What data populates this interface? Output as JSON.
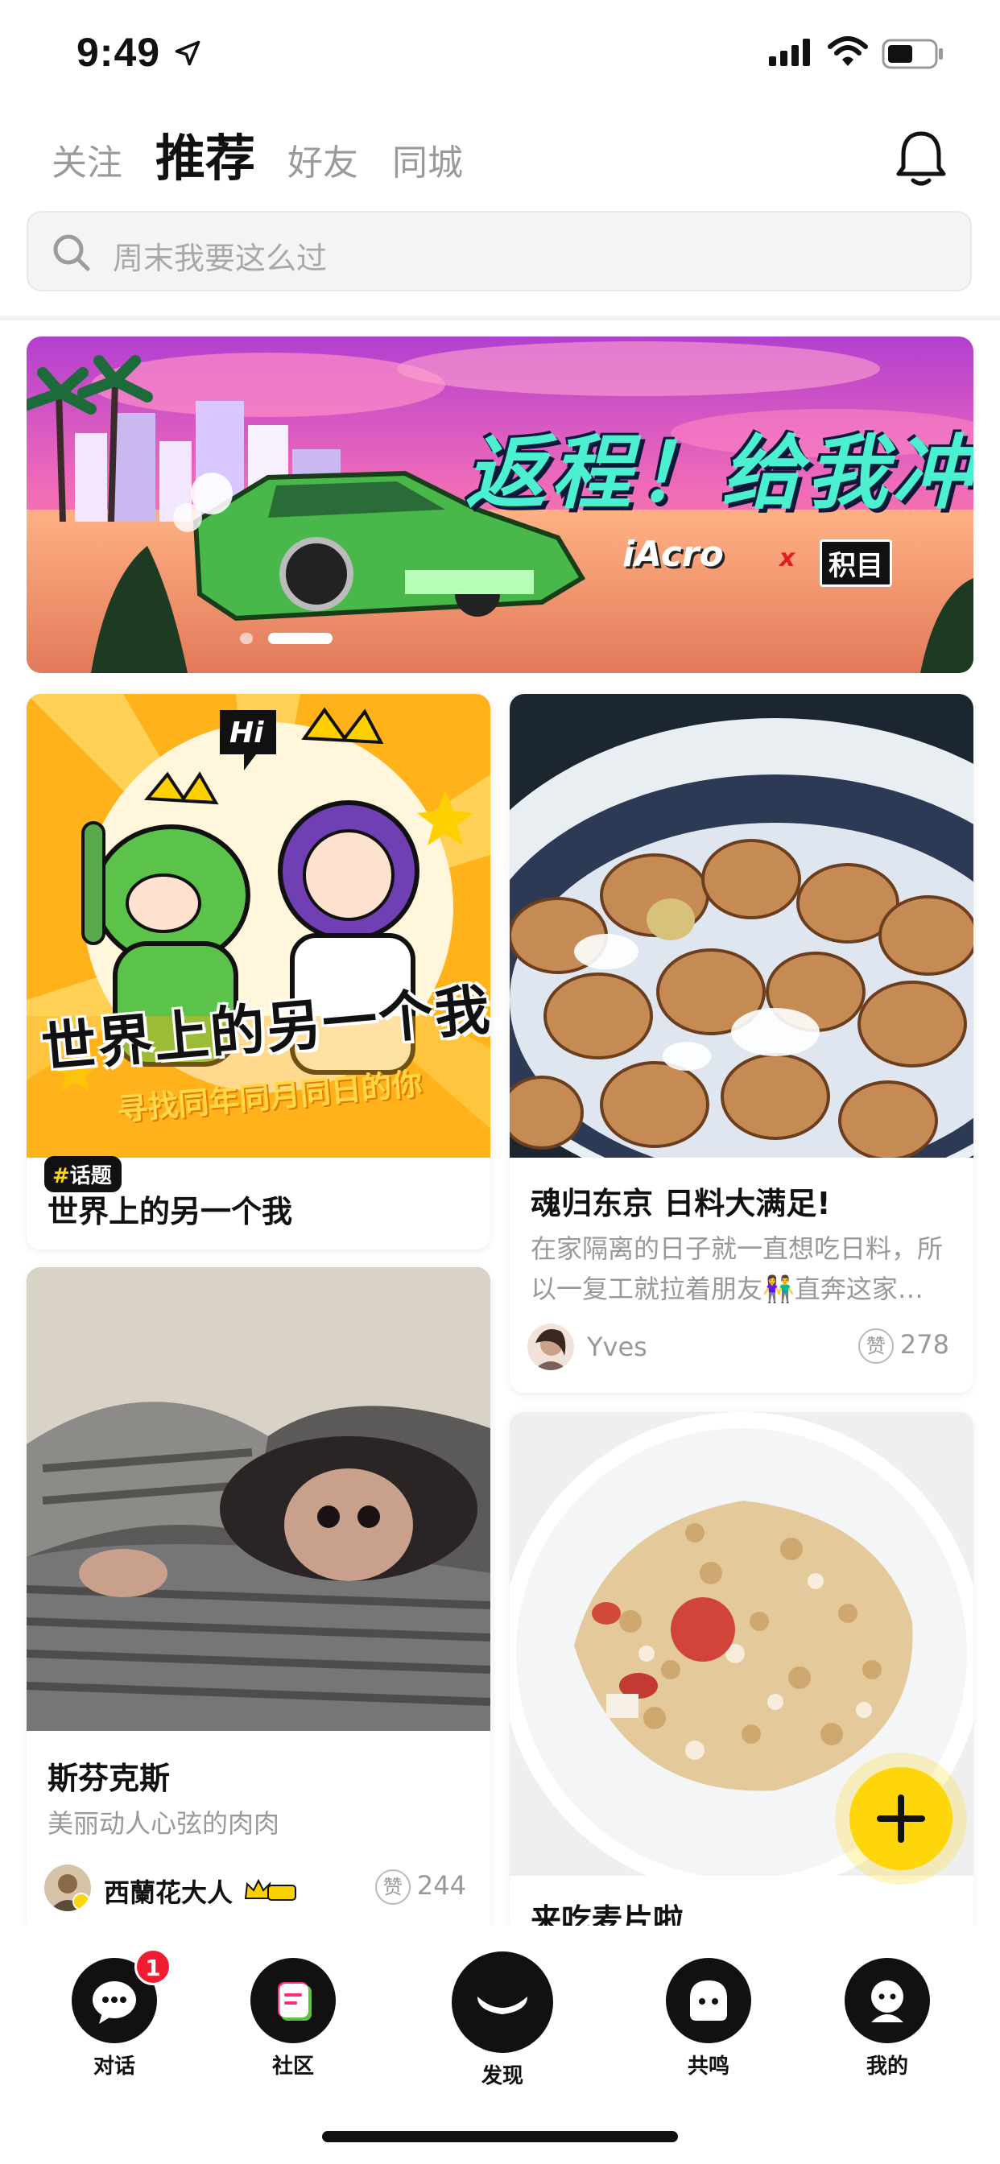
{
  "status": {
    "time": "9:49"
  },
  "tabs": [
    {
      "label": "关注"
    },
    {
      "label": "推荐"
    },
    {
      "label": "好友"
    },
    {
      "label": "同城"
    }
  ],
  "search": {
    "placeholder": "周末我要这么过"
  },
  "banner": {
    "title": "返程！给我冲!",
    "brand": "iAcro",
    "x": "x",
    "partner": "积目"
  },
  "feed": {
    "topic": {
      "badge_hash": "#",
      "badge": "话题",
      "title": "世界上的另一个我",
      "art_title": "世界上的另一个我",
      "art_sub": "寻找同年同月同日的你",
      "art_hi": "Hi"
    },
    "post_food": {
      "title": "魂归东京 日料大满足!",
      "desc_line1": "在家隔离的日子就一直想吃日料，所",
      "desc_line2": "以一复工就拉着朋友👫直奔这家…",
      "author": "Yves",
      "likes": "278"
    },
    "post_sphynx": {
      "title": "斯芬克斯",
      "desc": "美丽动人心弦的肉肉",
      "author": "西蘭花大人",
      "likes": "244"
    },
    "post_cereal": {
      "title": "来吃麦片啦"
    },
    "like_char": "赞"
  },
  "bottom_nav": [
    {
      "label": "对话",
      "badge": "1"
    },
    {
      "label": "社区"
    },
    {
      "label": "发现"
    },
    {
      "label": "共鸣"
    },
    {
      "label": "我的"
    }
  ],
  "colors": {
    "accent": "#ffd60a",
    "badge": "#f01c30",
    "text": "#111111",
    "muted": "#999999"
  }
}
